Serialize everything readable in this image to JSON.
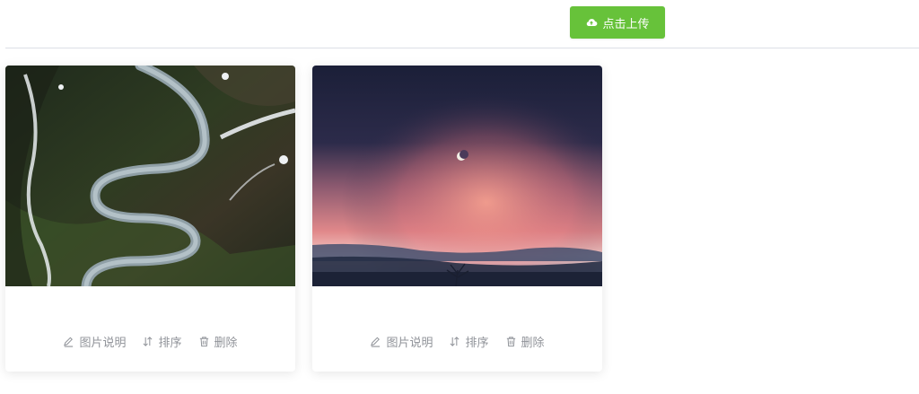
{
  "toolbar": {
    "upload_label": "点击上传",
    "upload_icon": "cloud-upload-icon",
    "upload_color": "#67c23a"
  },
  "cards": [
    {
      "image_subject": "aerial-winding-mountain-road",
      "actions": {
        "caption": "图片说明",
        "sort": "排序",
        "delete": "删除"
      }
    },
    {
      "image_subject": "night-sky-crescent-moon-pink-horizon",
      "actions": {
        "caption": "图片说明",
        "sort": "排序",
        "delete": "删除"
      }
    }
  ],
  "icons": {
    "caption": "edit-icon",
    "sort": "sort-icon",
    "delete": "trash-icon"
  },
  "colors": {
    "action_text": "#909399",
    "divider": "#dcdfe6"
  }
}
